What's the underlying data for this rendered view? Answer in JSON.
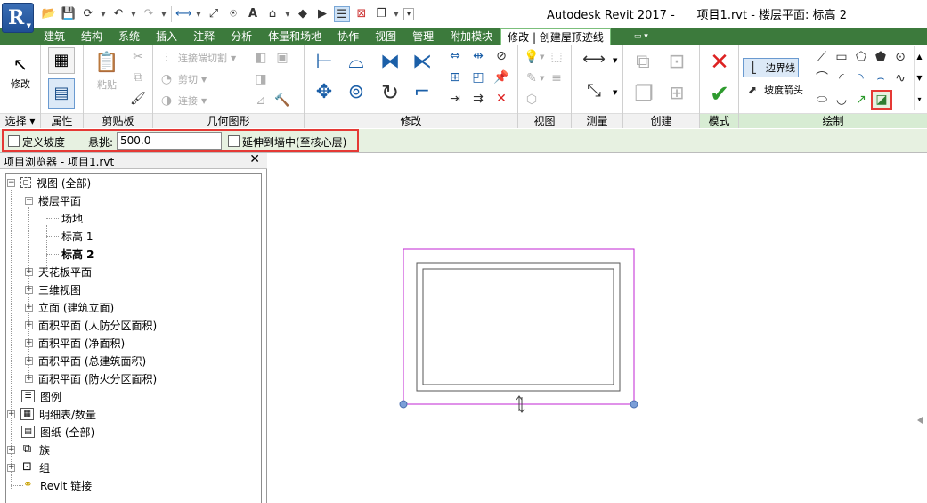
{
  "app": {
    "logo_letter": "R",
    "title": "Autodesk Revit 2017 -      项目1.rvt - 楼层平面: 标高 2"
  },
  "qat": {
    "icons": [
      "open-icon",
      "save-icon",
      "sync-icon",
      "undo-icon",
      "redo-icon",
      "measure-icon",
      "dimension-icon",
      "tag-icon",
      "text-icon",
      "3d-view-icon",
      "section-icon",
      "thin-lines-icon",
      "close-hidden-icon",
      "switch-windows-icon",
      "customize-icon"
    ]
  },
  "tabs": [
    {
      "label": "建筑"
    },
    {
      "label": "结构"
    },
    {
      "label": "系统"
    },
    {
      "label": "插入"
    },
    {
      "label": "注释"
    },
    {
      "label": "分析"
    },
    {
      "label": "体量和场地"
    },
    {
      "label": "协作"
    },
    {
      "label": "视图"
    },
    {
      "label": "管理"
    },
    {
      "label": "附加模块"
    },
    {
      "label": "修改 | 创建屋顶迹线",
      "active": true
    }
  ],
  "ribbon": {
    "select": {
      "modify_label": "修改",
      "panel_label": "选择"
    },
    "properties": {
      "panel_label": "属性"
    },
    "clipboard": {
      "paste_label": "粘贴",
      "panel_label": "剪贴板"
    },
    "geometry": {
      "join_cut_label": "连接端切割",
      "cut_label": "剪切",
      "join_label": "连接",
      "panel_label": "几何图形"
    },
    "modify": {
      "panel_label": "修改"
    },
    "view": {
      "panel_label": "视图"
    },
    "measure": {
      "panel_label": "测量"
    },
    "create": {
      "panel_label": "创建"
    },
    "mode": {
      "panel_label": "模式"
    },
    "draw": {
      "boundary_line_label": "边界线",
      "slope_arrow_label": "坡度箭头",
      "panel_label": "绘制"
    }
  },
  "options_bar": {
    "define_slope_label": "定义坡度",
    "define_slope_checked": false,
    "overhang_label": "悬挑:",
    "overhang_value": "500.0",
    "extend_to_wall_label": "延伸到墙中(至核心层)",
    "extend_to_wall_checked": false
  },
  "browser": {
    "title": "项目浏览器 - 项目1.rvt",
    "close": "✕",
    "tree": [
      {
        "label": "视图 (全部)",
        "level": 0,
        "expander": "−"
      },
      {
        "label": "楼层平面",
        "level": 1,
        "expander": "−"
      },
      {
        "label": "场地",
        "level": 2
      },
      {
        "label": "标高 1",
        "level": 2
      },
      {
        "label": "标高 2",
        "level": 2,
        "bold": true
      },
      {
        "label": "天花板平面",
        "level": 1,
        "expander": "+"
      },
      {
        "label": "三维视图",
        "level": 1,
        "expander": "+"
      },
      {
        "label": "立面 (建筑立面)",
        "level": 1,
        "expander": "+"
      },
      {
        "label": "面积平面 (人防分区面积)",
        "level": 1,
        "expander": "+"
      },
      {
        "label": "面积平面 (净面积)",
        "level": 1,
        "expander": "+"
      },
      {
        "label": "面积平面 (总建筑面积)",
        "level": 1,
        "expander": "+"
      },
      {
        "label": "面积平面 (防火分区面积)",
        "level": 1,
        "expander": "+"
      },
      {
        "label": "图例",
        "level": 0
      },
      {
        "label": "明细表/数量",
        "level": 0,
        "expander": "+"
      },
      {
        "label": "图纸 (全部)",
        "level": 0
      },
      {
        "label": "族",
        "level": 0,
        "expander": "+"
      },
      {
        "label": "组",
        "level": 0,
        "expander": "+"
      },
      {
        "label": "Revit 链接",
        "level": 0
      }
    ]
  },
  "colors": {
    "ribbon_tab_bg": "#3c7a3c",
    "options_bar_bg": "#e7f1e1",
    "sketch_line": "#c026d3",
    "highlight": "#e53935",
    "wall": "#555555"
  }
}
